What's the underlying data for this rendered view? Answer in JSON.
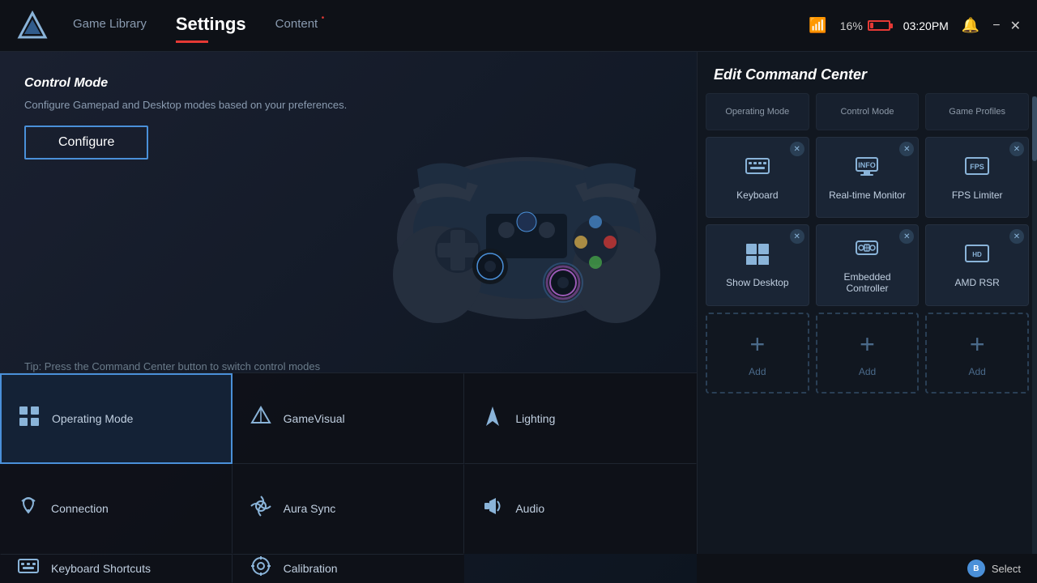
{
  "app": {
    "logo_alt": "ASUS Logo"
  },
  "topbar": {
    "nav": [
      {
        "id": "game-library",
        "label": "Game Library",
        "active": false,
        "has_dot": false
      },
      {
        "id": "settings",
        "label": "Settings",
        "active": true,
        "has_dot": false
      },
      {
        "id": "content",
        "label": "Content",
        "active": false,
        "has_dot": true
      }
    ],
    "battery_percent": "16%",
    "time": "03:20PM",
    "minimize_label": "−",
    "close_label": "✕"
  },
  "left_panel": {
    "control_mode": {
      "title": "Control Mode",
      "description": "Configure Gamepad and Desktop modes based on your preferences.",
      "configure_label": "Configure",
      "tip": "Tip: Press the Command Center button to switch control modes"
    },
    "menu_items": [
      {
        "id": "operating-mode",
        "label": "Operating Mode",
        "icon": "⊞",
        "active": true
      },
      {
        "id": "gamevisual",
        "label": "GameVisual",
        "icon": "◈",
        "active": false
      },
      {
        "id": "lighting",
        "label": "Lighting",
        "icon": "⚡",
        "active": false
      },
      {
        "id": "connection",
        "label": "Connection",
        "icon": "📶",
        "active": false
      },
      {
        "id": "aura-sync",
        "label": "Aura Sync",
        "icon": "◉",
        "active": false
      },
      {
        "id": "audio",
        "label": "Audio",
        "icon": "🔊",
        "active": false
      },
      {
        "id": "keyboard-shortcuts",
        "label": "Keyboard Shortcuts",
        "icon": "⌨",
        "active": false
      },
      {
        "id": "calibration",
        "label": "Calibration",
        "icon": "⊕",
        "active": false
      }
    ]
  },
  "right_panel": {
    "title": "Edit Command Center",
    "partial_top_row": [
      {
        "label": "Operating Mode"
      },
      {
        "label": "Control Mode"
      },
      {
        "label": "Game Profiles"
      }
    ],
    "rows": [
      {
        "cards": [
          {
            "id": "keyboard",
            "label": "Keyboard",
            "icon": "⌨",
            "removable": true
          },
          {
            "id": "realtime-monitor",
            "label": "Real-time Monitor",
            "icon": "ℹ",
            "removable": true
          },
          {
            "id": "fps-limiter",
            "label": "FPS Limiter",
            "icon": "FPS",
            "removable": true
          }
        ]
      },
      {
        "cards": [
          {
            "id": "show-desktop",
            "label": "Show Desktop",
            "icon": "⊞",
            "removable": true
          },
          {
            "id": "embedded-controller",
            "label": "Embedded Controller",
            "icon": "🎮",
            "removable": true
          },
          {
            "id": "amd-rsr",
            "label": "AMD RSR",
            "icon": "HD",
            "removable": true
          }
        ]
      },
      {
        "cards": [
          {
            "id": "add-1",
            "label": "Add",
            "icon": "+",
            "removable": false,
            "is_add": true
          },
          {
            "id": "add-2",
            "label": "Add",
            "icon": "+",
            "removable": false,
            "is_add": true
          },
          {
            "id": "add-3",
            "label": "Add",
            "icon": "+",
            "removable": false,
            "is_add": true
          }
        ]
      }
    ],
    "select_hint": "Select"
  },
  "colors": {
    "accent_blue": "#4a90d9",
    "accent_red": "#e53935",
    "bg_dark": "#0e1117",
    "bg_card": "#1a2535",
    "text_secondary": "#8a9bb0"
  }
}
